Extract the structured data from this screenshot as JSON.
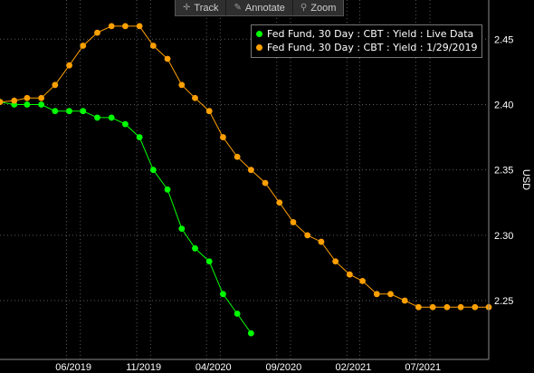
{
  "toolbar": {
    "track_label": "Track",
    "annotate_label": "Annotate",
    "zoom_label": "Zoom",
    "track_icon": "crosshair-icon",
    "annotate_icon": "pencil-icon",
    "zoom_icon": "magnifier-icon"
  },
  "colors": {
    "background": "#000000",
    "grid": "#5a5a5a",
    "live": "#00ff00",
    "past": "#ffa000",
    "axis_text": "#ffffff"
  },
  "chart_data": {
    "type": "line",
    "title": "",
    "xlabel": "",
    "ylabel": "USD",
    "ylim": [
      2.205,
      2.48
    ],
    "xlim": [
      "2019-01-07",
      "2021-12-07"
    ],
    "yticks": [
      "2.25",
      "2.30",
      "2.35",
      "2.40",
      "2.45"
    ],
    "xticks": [
      "06/2019",
      "11/2019",
      "04/2020",
      "09/2020",
      "02/2021",
      "07/2021"
    ],
    "grid": true,
    "legend_position": "top-right",
    "series": [
      {
        "name": "Fed Fund, 30 Day : CBT : Yield : Live Data",
        "color": "#00ff00",
        "x": [
          "2019-01",
          "2019-02",
          "2019-03",
          "2019-04",
          "2019-05",
          "2019-06",
          "2019-07",
          "2019-08",
          "2019-09",
          "2019-10",
          "2019-11",
          "2019-12",
          "2020-01",
          "2020-02",
          "2020-03",
          "2020-04",
          "2020-05",
          "2020-06",
          "2020-07"
        ],
        "y": [
          2.402,
          2.4,
          2.4,
          2.4,
          2.395,
          2.395,
          2.395,
          2.39,
          2.39,
          2.385,
          2.375,
          2.35,
          2.335,
          2.305,
          2.29,
          2.28,
          2.255,
          2.24,
          2.225
        ]
      },
      {
        "name": "Fed Fund, 30 Day : CBT : Yield : 1/29/2019",
        "color": "#ffa000",
        "x": [
          "2019-01",
          "2019-02",
          "2019-03",
          "2019-04",
          "2019-05",
          "2019-06",
          "2019-07",
          "2019-08",
          "2019-09",
          "2019-10",
          "2019-11",
          "2019-12",
          "2020-01",
          "2020-02",
          "2020-03",
          "2020-04",
          "2020-05",
          "2020-06",
          "2020-07",
          "2020-08",
          "2020-09",
          "2020-10",
          "2020-11",
          "2020-12",
          "2021-01",
          "2021-02",
          "2021-03",
          "2021-04",
          "2021-05",
          "2021-06",
          "2021-07",
          "2021-08",
          "2021-09",
          "2021-10",
          "2021-11",
          "2021-12"
        ],
        "y": [
          2.402,
          2.403,
          2.405,
          2.405,
          2.415,
          2.43,
          2.445,
          2.455,
          2.46,
          2.46,
          2.46,
          2.445,
          2.435,
          2.415,
          2.405,
          2.395,
          2.375,
          2.36,
          2.35,
          2.34,
          2.325,
          2.31,
          2.3,
          2.295,
          2.28,
          2.27,
          2.265,
          2.255,
          2.255,
          2.25,
          2.245,
          2.245,
          2.245,
          2.245,
          2.245,
          2.245
        ]
      }
    ]
  }
}
